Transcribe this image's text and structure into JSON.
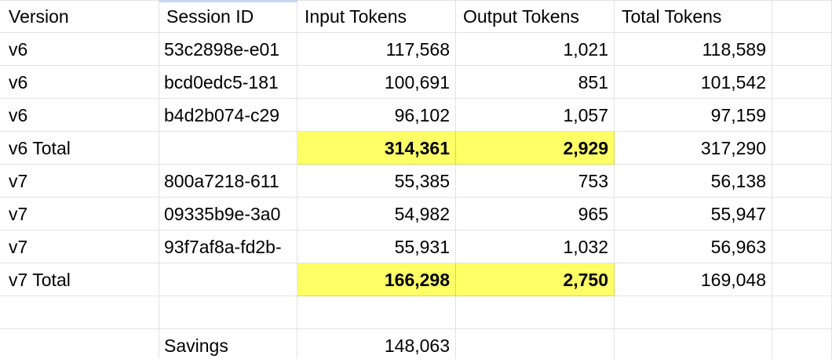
{
  "headers": [
    "Version",
    "Session ID",
    "Input Tokens",
    "Output Tokens",
    "Total Tokens",
    ""
  ],
  "rows": [
    {
      "version": "v6",
      "session": "53c2898e-e01",
      "input": "117,568",
      "output": "1,021",
      "total": "118,589",
      "highlight": false
    },
    {
      "version": "v6",
      "session": "bcd0edc5-181",
      "input": "100,691",
      "output": "851",
      "total": "101,542",
      "highlight": false
    },
    {
      "version": "v6",
      "session": "b4d2b074-c29",
      "input": "96,102",
      "output": "1,057",
      "total": "97,159",
      "highlight": false
    },
    {
      "version": "v6 Total",
      "session": "",
      "input": "314,361",
      "output": "2,929",
      "total": "317,290",
      "highlight": true
    },
    {
      "version": "v7",
      "session": "800a7218-611",
      "input": "55,385",
      "output": "753",
      "total": "56,138",
      "highlight": false
    },
    {
      "version": "v7",
      "session": "09335b9e-3a0",
      "input": "54,982",
      "output": "965",
      "total": "55,947",
      "highlight": false
    },
    {
      "version": "v7",
      "session": "93f7af8a-fd2b-",
      "input": "55,931",
      "output": "1,032",
      "total": "56,963",
      "highlight": false
    },
    {
      "version": "v7 Total",
      "session": "",
      "input": "166,298",
      "output": "2,750",
      "total": "169,048",
      "highlight": true
    },
    {
      "version": "",
      "session": "",
      "input": "",
      "output": "",
      "total": "",
      "highlight": false
    },
    {
      "version": "",
      "session": "Savings",
      "input": "148,063",
      "output": "",
      "total": "",
      "highlight": false
    }
  ],
  "colors": {
    "highlight": "#ffff66",
    "gridline": "#e2e3e3",
    "text": "#000000"
  }
}
